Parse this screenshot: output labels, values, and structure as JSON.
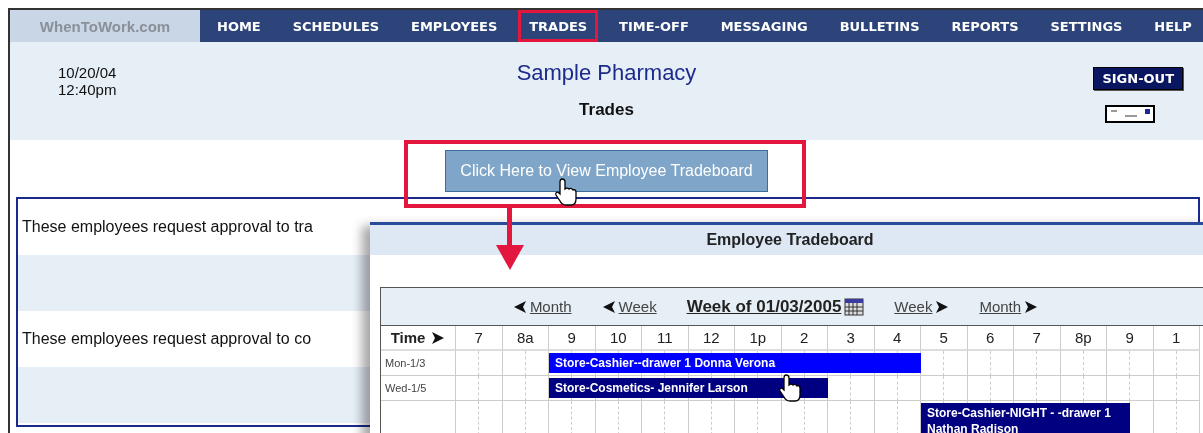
{
  "nav": {
    "logo": "WhenToWork.com",
    "items": [
      {
        "label": "HOME",
        "selected": false
      },
      {
        "label": "SCHEDULES",
        "selected": false
      },
      {
        "label": "EMPLOYEES",
        "selected": false
      },
      {
        "label": "TRADES",
        "selected": true
      },
      {
        "label": "TIME-OFF",
        "selected": false
      },
      {
        "label": "MESSAGING",
        "selected": false
      },
      {
        "label": "BULLETINS",
        "selected": false
      },
      {
        "label": "REPORTS",
        "selected": false
      },
      {
        "label": "SETTINGS",
        "selected": false
      },
      {
        "label": "HELP",
        "selected": false
      }
    ]
  },
  "header": {
    "date": "10/20/04",
    "time": "12:40pm",
    "company": "Sample Pharmacy",
    "page_title": "Trades",
    "sign_out": "SIGN-OUT"
  },
  "view_button": {
    "label": "Click Here to View Employee Tradeboard"
  },
  "requests": [
    {
      "text": "These employees request approval to tra"
    },
    {
      "text": "These employees request approval to co"
    }
  ],
  "tradeboard": {
    "title": "Employee Tradeboard",
    "nav": {
      "prev_month": "Month",
      "prev_week": "Week",
      "week_label": "Week of 01/03/2005",
      "next_week": "Week",
      "next_month": "Month"
    },
    "time_label": "Time",
    "hours": [
      "7",
      "8a",
      "9",
      "10",
      "11",
      "12",
      "1p",
      "2",
      "3",
      "4",
      "5",
      "6",
      "7",
      "8p",
      "9",
      "1"
    ],
    "rows": [
      {
        "day": "Mon-1/3",
        "cells": [
          {
            "kind": "free"
          },
          {
            "kind": "free"
          },
          {
            "kind": "free"
          },
          {
            "kind": "free"
          },
          {
            "kind": "shift",
            "label": "Store-Cashier--drawer 1 Donna Verona",
            "color": "#0000ff"
          },
          {
            "kind": "cont"
          },
          {
            "kind": "cont"
          },
          {
            "kind": "cont"
          },
          {
            "kind": "cont"
          },
          {
            "kind": "cont"
          },
          {
            "kind": "cont"
          },
          {
            "kind": "cont"
          },
          {
            "kind": "cont"
          },
          {
            "kind": "cont"
          },
          {
            "kind": "cont"
          },
          {
            "kind": "cont"
          },
          {
            "kind": "cont"
          },
          {
            "kind": "cont"
          },
          {
            "kind": "cont"
          },
          {
            "kind": "cont"
          },
          {
            "kind": "free"
          },
          {
            "kind": "free"
          },
          {
            "kind": "free"
          },
          {
            "kind": "free"
          },
          {
            "kind": "free"
          },
          {
            "kind": "free"
          },
          {
            "kind": "free"
          },
          {
            "kind": "free"
          },
          {
            "kind": "free"
          },
          {
            "kind": "free"
          },
          {
            "kind": "free"
          },
          {
            "kind": "free"
          }
        ]
      },
      {
        "day": "Wed-1/5",
        "cells": [
          {
            "kind": "free"
          },
          {
            "kind": "free"
          },
          {
            "kind": "free"
          },
          {
            "kind": "free"
          },
          {
            "kind": "shift",
            "label": "Store-Cosmetics- Jennifer Larson",
            "color": "#000080"
          },
          {
            "kind": "cont"
          },
          {
            "kind": "cont"
          },
          {
            "kind": "cont"
          },
          {
            "kind": "cont"
          },
          {
            "kind": "cont"
          },
          {
            "kind": "cont"
          },
          {
            "kind": "cont"
          },
          {
            "kind": "cont"
          },
          {
            "kind": "cont"
          },
          {
            "kind": "cont"
          },
          {
            "kind": "cont"
          },
          {
            "kind": "free"
          },
          {
            "kind": "free"
          },
          {
            "kind": "free"
          },
          {
            "kind": "free"
          },
          {
            "kind": "free"
          },
          {
            "kind": "free"
          },
          {
            "kind": "free"
          },
          {
            "kind": "free"
          },
          {
            "kind": "free"
          },
          {
            "kind": "free"
          },
          {
            "kind": "free"
          },
          {
            "kind": "free"
          },
          {
            "kind": "free"
          },
          {
            "kind": "free"
          },
          {
            "kind": "free"
          },
          {
            "kind": "free"
          }
        ]
      },
      {
        "cells": [
          {
            "kind": "free"
          },
          {
            "kind": "free"
          },
          {
            "kind": "free"
          },
          {
            "kind": "free"
          },
          {
            "kind": "free"
          },
          {
            "kind": "free"
          },
          {
            "kind": "free"
          },
          {
            "kind": "free"
          },
          {
            "kind": "free"
          },
          {
            "kind": "free"
          },
          {
            "kind": "free"
          },
          {
            "kind": "free"
          },
          {
            "kind": "free"
          },
          {
            "kind": "free"
          },
          {
            "kind": "free"
          },
          {
            "kind": "free"
          },
          {
            "kind": "free"
          },
          {
            "kind": "free"
          },
          {
            "kind": "free"
          },
          {
            "kind": "free"
          },
          {
            "kind": "shift",
            "label": "Store-Cashier-NIGHT - -drawer 1 Nathan Radison",
            "color": "#000080"
          },
          {
            "kind": "cont"
          },
          {
            "kind": "cont"
          },
          {
            "kind": "cont"
          },
          {
            "kind": "cont"
          },
          {
            "kind": "cont"
          },
          {
            "kind": "cont"
          },
          {
            "kind": "cont"
          },
          {
            "kind": "cont"
          },
          {
            "kind": "free"
          },
          {
            "kind": "free"
          },
          {
            "kind": "free"
          }
        ]
      }
    ]
  }
}
